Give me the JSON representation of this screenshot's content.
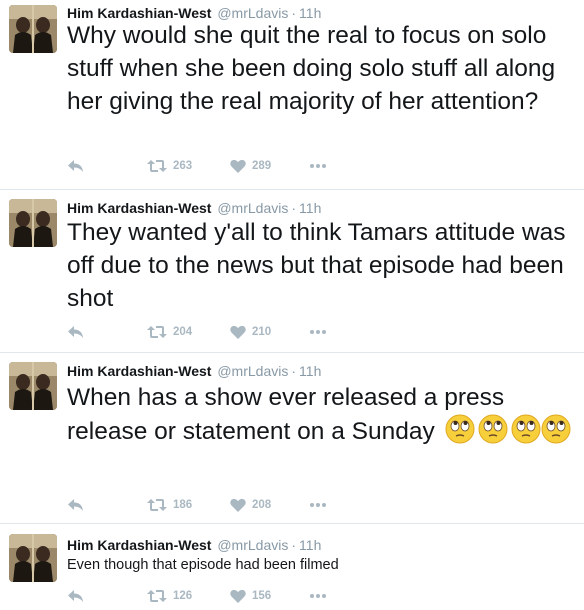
{
  "tweets": [
    {
      "author": "Him Kardashian-West",
      "handle": "@mrLdavis",
      "separator": "·",
      "time": "11h",
      "text": "Why would she quit the real to focus on solo stuff when she been doing solo stuff all along her giving the real majority of her attention?",
      "retweets": "263",
      "likes": "289"
    },
    {
      "author": "Him Kardashian-West",
      "handle": "@mrLdavis",
      "separator": "·",
      "time": "11h",
      "text": "They wanted y'all to think Tamars attitude was off due to the news but that episode had been shot",
      "retweets": "204",
      "likes": "210"
    },
    {
      "author": "Him Kardashian-West",
      "handle": "@mrLdavis",
      "separator": "·",
      "time": "11h",
      "text": "When has a show ever released a press release or statement on a Sunday",
      "emoji": "face-with-rolling-eyes-emoji",
      "emoji_count": 4,
      "retweets": "186",
      "likes": "208"
    },
    {
      "author": "Him Kardashian-West",
      "handle": "@mrLdavis",
      "separator": "·",
      "time": "11h",
      "text": "Even though that episode had been filmed",
      "retweets": "126",
      "likes": "156"
    }
  ],
  "icons": {
    "reply": "reply-icon",
    "retweet": "retweet-icon",
    "like": "heart-icon",
    "more": "more-icon"
  },
  "colors": {
    "icon_gray": "#aab8c2",
    "meta_gray": "#8899a6",
    "divider": "#e1e8ed"
  }
}
